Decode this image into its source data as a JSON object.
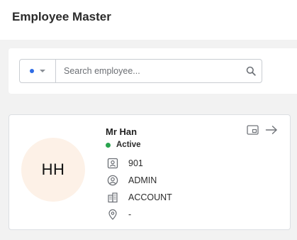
{
  "page": {
    "title": "Employee Master"
  },
  "search": {
    "placeholder": "Search employee...",
    "value": "",
    "filter_dot_color": "#2f6ce5"
  },
  "employee": {
    "initials": "HH",
    "name": "Mr Han",
    "status": "Active",
    "status_color": "#2aa44f",
    "avatar_bg": "#fdf1e7",
    "id": "901",
    "role": "ADMIN",
    "department": "ACCOUNT",
    "location": "-"
  },
  "icons": {
    "filter_dot": "dot-icon",
    "filter_caret": "chevron-down-icon",
    "search": "search-icon",
    "id": "id-badge-icon",
    "role": "user-circle-icon",
    "department": "building-icon",
    "location": "map-pin-icon",
    "preview": "picture-in-picture-icon",
    "open": "arrow-right-icon"
  }
}
